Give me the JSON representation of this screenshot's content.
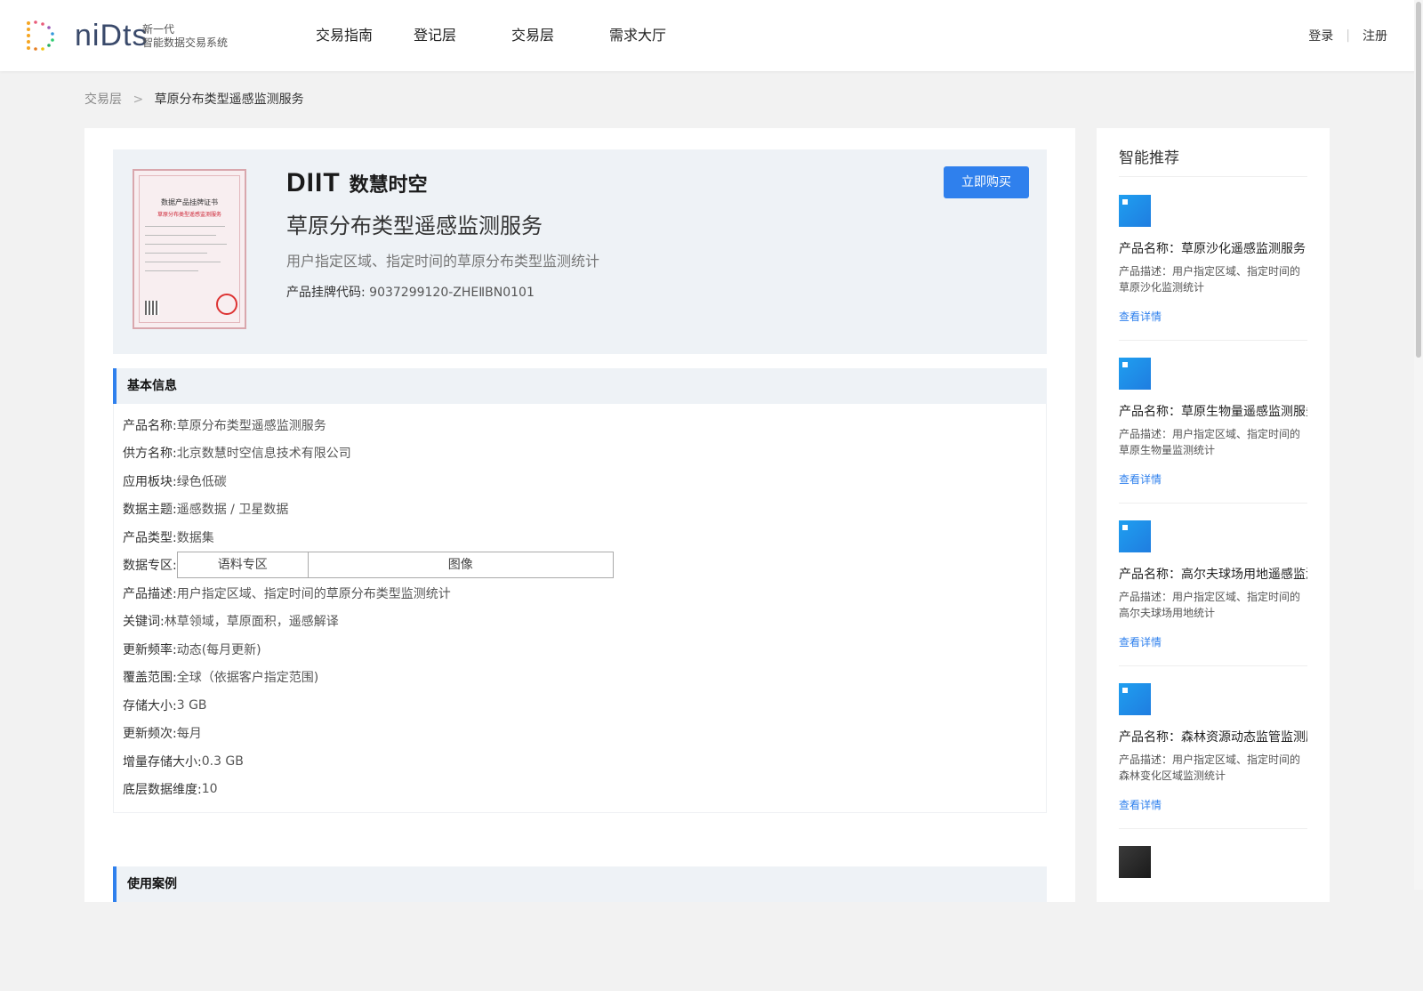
{
  "header": {
    "logo_word": "niDts",
    "logo_sub_line1": "新一代",
    "logo_sub_line2": "智能数据交易系统",
    "nav": [
      "交易指南",
      "登记层",
      "交易层",
      "需求大厅"
    ],
    "login": "登录",
    "register": "注册",
    "sep": "|"
  },
  "breadcrumb": {
    "parent": "交易层",
    "current": "草原分布类型遥感监测服务",
    "sep": ">"
  },
  "product": {
    "cert_title": "数据产品挂牌证书",
    "cert_subtitle": "草原分布类型遥感监测服务",
    "brand_mark": "DIIT",
    "brand_name": "数慧时空",
    "title": "草原分布类型遥感监测服务",
    "subtitle": "用户指定区域、指定时间的草原分布类型监测统计",
    "code_label": "产品挂牌代码:",
    "code_value": "9037299120-ZHEⅡBN0101",
    "buy_button": "立即购买"
  },
  "basic_info": {
    "heading": "基本信息",
    "rows": [
      {
        "k": "产品名称:",
        "v": "草原分布类型遥感监测服务"
      },
      {
        "k": "供方名称:",
        "v": "北京数慧时空信息技术有限公司"
      },
      {
        "k": "应用板块:",
        "v": "绿色低碳"
      },
      {
        "k": "数据主题:",
        "v": "遥感数据 / 卫星数据"
      },
      {
        "k": "产品类型:",
        "v": "数据集"
      },
      {
        "k": "数据专区:",
        "cells": [
          "语料专区",
          "图像"
        ]
      },
      {
        "k": "产品描述:",
        "v": "用户指定区域、指定时间的草原分布类型监测统计"
      },
      {
        "k": "关键词:",
        "v": "林草领域，草原面积，遥感解译"
      },
      {
        "k": "更新频率:",
        "v": "动态(每月更新)"
      },
      {
        "k": "覆盖范围:",
        "v": "全球（依据客户指定范围)"
      },
      {
        "k": "存储大小:",
        "v": "3 GB"
      },
      {
        "k": "更新频次:",
        "v": "每月"
      },
      {
        "k": "增量存储大小:",
        "v": "0.3 GB"
      },
      {
        "k": "底层数据维度:",
        "v": "10"
      }
    ]
  },
  "use_case": {
    "heading": "使用案例"
  },
  "sidebar": {
    "title": "智能推荐",
    "items": [
      {
        "name": "产品名称：草原沙化遥感监测服务",
        "desc": "产品描述：用户指定区域、指定时间的草原沙化监测统计",
        "link": "查看详情"
      },
      {
        "name": "产品名称：草原生物量遥感监测服务",
        "desc": "产品描述：用户指定区域、指定时间的草原生物量监测统计",
        "link": "查看详情"
      },
      {
        "name": "产品名称：高尔夫球场用地遥感监测服务",
        "desc": "产品描述：用户指定区域、指定时间的高尔夫球场用地统计",
        "link": "查看详情"
      },
      {
        "name": "产品名称：森林资源动态监管监测服务",
        "desc": "产品描述：用户指定区域、指定时间的森林变化区域监测统计",
        "link": "查看详情"
      }
    ]
  },
  "colors": {
    "accent": "#2f80ed",
    "page_bg": "#f2f2f2",
    "hero_bg": "#eef2f6"
  }
}
